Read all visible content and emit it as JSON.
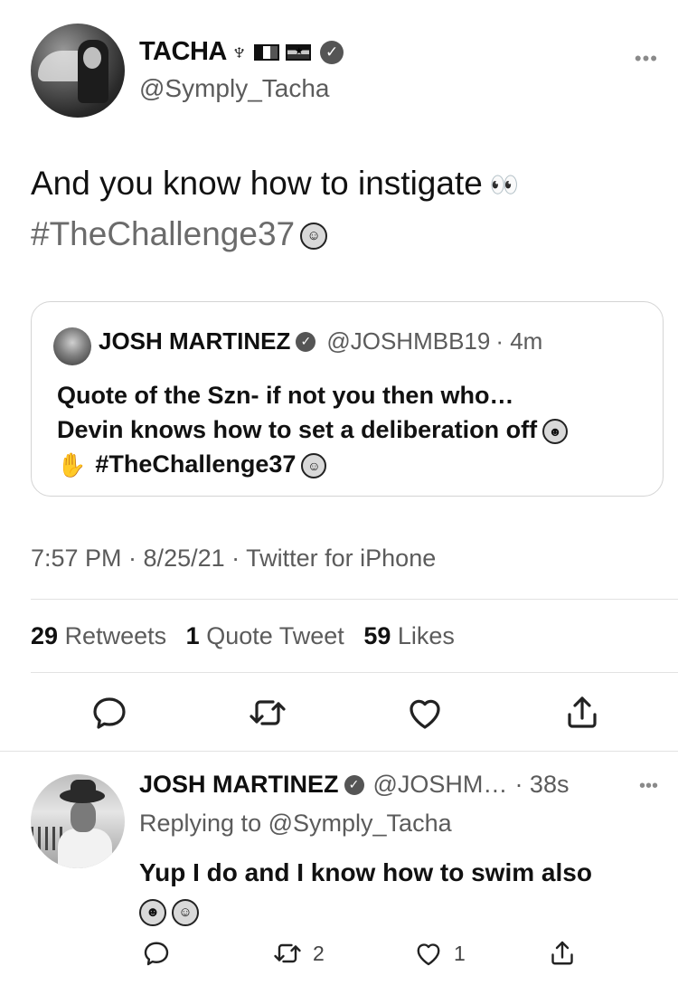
{
  "tweet": {
    "display_name": "TACHA",
    "handle": "@Symply_Tacha",
    "text": "And you know how to instigate",
    "hashtag": "#TheChallenge37",
    "timestamp": "7:57 PM · 8/25/21 · Twitter for iPhone"
  },
  "quoted": {
    "display_name": "JOSH MARTINEZ",
    "handle": "@JOSHMBB19",
    "time": "· 4m",
    "line1": "Quote of the Szn- if not you then who…",
    "line2": "Devin knows how to set a deliberation off",
    "hashtag": "#TheChallenge37"
  },
  "stats": {
    "retweets_count": "29",
    "retweets_label": "Retweets",
    "quotes_count": "1",
    "quotes_label": "Quote Tweet",
    "likes_count": "59",
    "likes_label": "Likes"
  },
  "reply": {
    "display_name": "JOSH MARTINEZ",
    "handle": "@JOSHM…",
    "time": "· 38s",
    "replying_prefix": "Replying to",
    "replying_to": "@Symply_Tacha",
    "text": "Yup I do and I know how to swim also",
    "retweet_count": "2",
    "like_count": "1"
  },
  "icons": {
    "more": "more-horizontal-icon",
    "verified": "verified-badge-icon",
    "reply": "reply-icon",
    "retweet": "retweet-icon",
    "like": "heart-icon",
    "share": "share-icon"
  },
  "colors": {
    "text": "#0f0f0f",
    "secondary": "#5b5b5b",
    "border": "#d4d4d4",
    "hashtag": "#6b6b6b"
  }
}
